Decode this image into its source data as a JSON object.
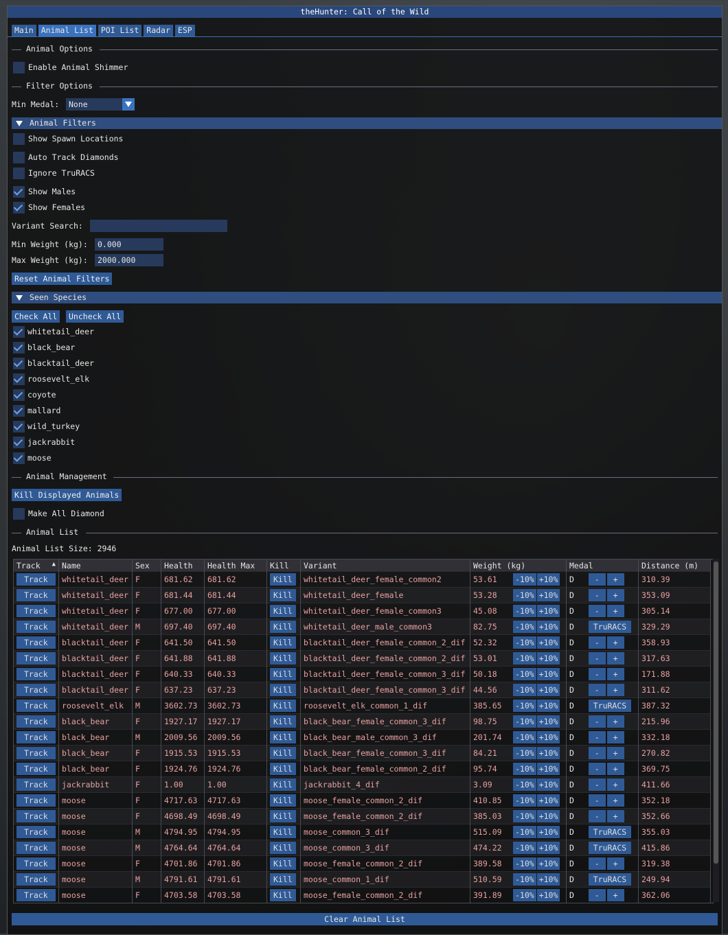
{
  "window": {
    "title": "theHunter: Call of the Wild"
  },
  "tabs": [
    "Main",
    "Animal List",
    "POI List",
    "Radar",
    "ESP"
  ],
  "animal_options": {
    "label": "Animal Options",
    "shimmer_label": "Enable Animal Shimmer",
    "shimmer_checked": false
  },
  "filter_options": {
    "label": "Filter Options",
    "min_medal_label": "Min Medal:",
    "min_medal_value": "None"
  },
  "animal_filters": {
    "header": "Animal Filters",
    "options": [
      {
        "label": "Show Spawn Locations",
        "checked": false
      },
      {
        "label": "Auto Track Diamonds",
        "checked": false
      },
      {
        "label": "Ignore TruRACS",
        "checked": false
      },
      {
        "label": "Show Males",
        "checked": true
      },
      {
        "label": "Show Females",
        "checked": true
      }
    ],
    "variant_search_label": "Variant Search:",
    "variant_search_value": "",
    "min_weight_label": "Min Weight (kg):",
    "min_weight_value": "0.000",
    "max_weight_label": "Max Weight (kg):",
    "max_weight_value": "2000.000",
    "reset_label": "Reset Animal Filters"
  },
  "seen_species": {
    "header": "Seen Species",
    "check_all": "Check All",
    "uncheck_all": "Uncheck All",
    "species": [
      "whitetail_deer",
      "black_bear",
      "blacktail_deer",
      "roosevelt_elk",
      "coyote",
      "mallard",
      "wild_turkey",
      "jackrabbit",
      "moose"
    ]
  },
  "animal_management": {
    "label": "Animal Management",
    "kill_displayed": "Kill Displayed Animals",
    "make_diamond": "Make All Diamond"
  },
  "animal_list": {
    "label": "Animal List",
    "size_text": "Animal List Size: 2946",
    "columns": [
      "Track",
      "Name",
      "Sex",
      "Health",
      "Health Max",
      "Kill",
      "Variant",
      "Weight (kg)",
      "Medal",
      "Distance (m)"
    ],
    "track_btn": "Track",
    "kill_btn": "Kill",
    "minus_pct": "-10%",
    "plus_pct": "+10%",
    "minus": "-",
    "plus": "+",
    "truracs": "TruRACS",
    "rows": [
      {
        "name": "whitetail_deer",
        "sex": "F",
        "health": "681.62",
        "hmax": "681.62",
        "variant": "whitetail_deer_female_common2",
        "weight": "53.61",
        "medal": "D",
        "truracs": false,
        "dist": "310.39"
      },
      {
        "name": "whitetail_deer",
        "sex": "F",
        "health": "681.44",
        "hmax": "681.44",
        "variant": "whitetail_deer_female",
        "weight": "53.28",
        "medal": "D",
        "truracs": false,
        "dist": "353.09"
      },
      {
        "name": "whitetail_deer",
        "sex": "F",
        "health": "677.00",
        "hmax": "677.00",
        "variant": "whitetail_deer_female_common3",
        "weight": "45.08",
        "medal": "D",
        "truracs": false,
        "dist": "305.14"
      },
      {
        "name": "whitetail_deer",
        "sex": "M",
        "health": "697.40",
        "hmax": "697.40",
        "variant": "whitetail_deer_male_common3",
        "weight": "82.75",
        "medal": "D",
        "truracs": true,
        "dist": "329.29"
      },
      {
        "name": "blacktail_deer",
        "sex": "F",
        "health": "641.50",
        "hmax": "641.50",
        "variant": "blacktail_deer_female_common_2_dif",
        "weight": "52.32",
        "medal": "D",
        "truracs": false,
        "dist": "358.93"
      },
      {
        "name": "blacktail_deer",
        "sex": "F",
        "health": "641.88",
        "hmax": "641.88",
        "variant": "blacktail_deer_female_common_2_dif",
        "weight": "53.01",
        "medal": "D",
        "truracs": false,
        "dist": "317.63"
      },
      {
        "name": "blacktail_deer",
        "sex": "F",
        "health": "640.33",
        "hmax": "640.33",
        "variant": "blacktail_deer_female_common_3_dif",
        "weight": "50.18",
        "medal": "D",
        "truracs": false,
        "dist": "171.88"
      },
      {
        "name": "blacktail_deer",
        "sex": "F",
        "health": "637.23",
        "hmax": "637.23",
        "variant": "blacktail_deer_female_common_3_dif",
        "weight": "44.56",
        "medal": "D",
        "truracs": false,
        "dist": "311.62"
      },
      {
        "name": "roosevelt_elk",
        "sex": "M",
        "health": "3602.73",
        "hmax": "3602.73",
        "variant": "roosevelt_elk_common_1_dif",
        "weight": "385.65",
        "medal": "D",
        "truracs": true,
        "dist": "387.32"
      },
      {
        "name": "black_bear",
        "sex": "F",
        "health": "1927.17",
        "hmax": "1927.17",
        "variant": "black_bear_female_common_3_dif",
        "weight": "98.75",
        "medal": "D",
        "truracs": false,
        "dist": "215.96"
      },
      {
        "name": "black_bear",
        "sex": "M",
        "health": "2009.56",
        "hmax": "2009.56",
        "variant": "black_bear_male_common_3_dif",
        "weight": "201.74",
        "medal": "D",
        "truracs": false,
        "dist": "332.18"
      },
      {
        "name": "black_bear",
        "sex": "F",
        "health": "1915.53",
        "hmax": "1915.53",
        "variant": "black_bear_female_common_3_dif",
        "weight": "84.21",
        "medal": "D",
        "truracs": false,
        "dist": "270.82"
      },
      {
        "name": "black_bear",
        "sex": "F",
        "health": "1924.76",
        "hmax": "1924.76",
        "variant": "black_bear_female_common_2_dif",
        "weight": "95.74",
        "medal": "D",
        "truracs": false,
        "dist": "369.75"
      },
      {
        "name": "jackrabbit",
        "sex": "F",
        "health": "1.00",
        "hmax": "1.00",
        "variant": "jackrabbit_4_dif",
        "weight": "3.09",
        "medal": "D",
        "truracs": false,
        "dist": "411.66"
      },
      {
        "name": "moose",
        "sex": "F",
        "health": "4717.63",
        "hmax": "4717.63",
        "variant": "moose_female_common_2_dif",
        "weight": "410.85",
        "medal": "D",
        "truracs": false,
        "dist": "352.18"
      },
      {
        "name": "moose",
        "sex": "F",
        "health": "4698.49",
        "hmax": "4698.49",
        "variant": "moose_female_common_2_dif",
        "weight": "385.03",
        "medal": "D",
        "truracs": false,
        "dist": "352.66"
      },
      {
        "name": "moose",
        "sex": "M",
        "health": "4794.95",
        "hmax": "4794.95",
        "variant": "moose_common_3_dif",
        "weight": "515.09",
        "medal": "D",
        "truracs": true,
        "dist": "355.03"
      },
      {
        "name": "moose",
        "sex": "M",
        "health": "4764.64",
        "hmax": "4764.64",
        "variant": "moose_common_3_dif",
        "weight": "474.22",
        "medal": "D",
        "truracs": true,
        "dist": "415.86"
      },
      {
        "name": "moose",
        "sex": "F",
        "health": "4701.86",
        "hmax": "4701.86",
        "variant": "moose_female_common_2_dif",
        "weight": "389.58",
        "medal": "D",
        "truracs": false,
        "dist": "319.38"
      },
      {
        "name": "moose",
        "sex": "M",
        "health": "4791.61",
        "hmax": "4791.61",
        "variant": "moose_common_1_dif",
        "weight": "510.59",
        "medal": "D",
        "truracs": true,
        "dist": "249.94"
      },
      {
        "name": "moose",
        "sex": "F",
        "health": "4703.58",
        "hmax": "4703.58",
        "variant": "moose_female_common_2_dif",
        "weight": "391.89",
        "medal": "D",
        "truracs": false,
        "dist": "362.06"
      }
    ],
    "clear_label": "Clear Animal List"
  },
  "colors": {
    "accent": "#2f5a96",
    "title": "#29477a",
    "name_text": "#e8a0a0"
  }
}
